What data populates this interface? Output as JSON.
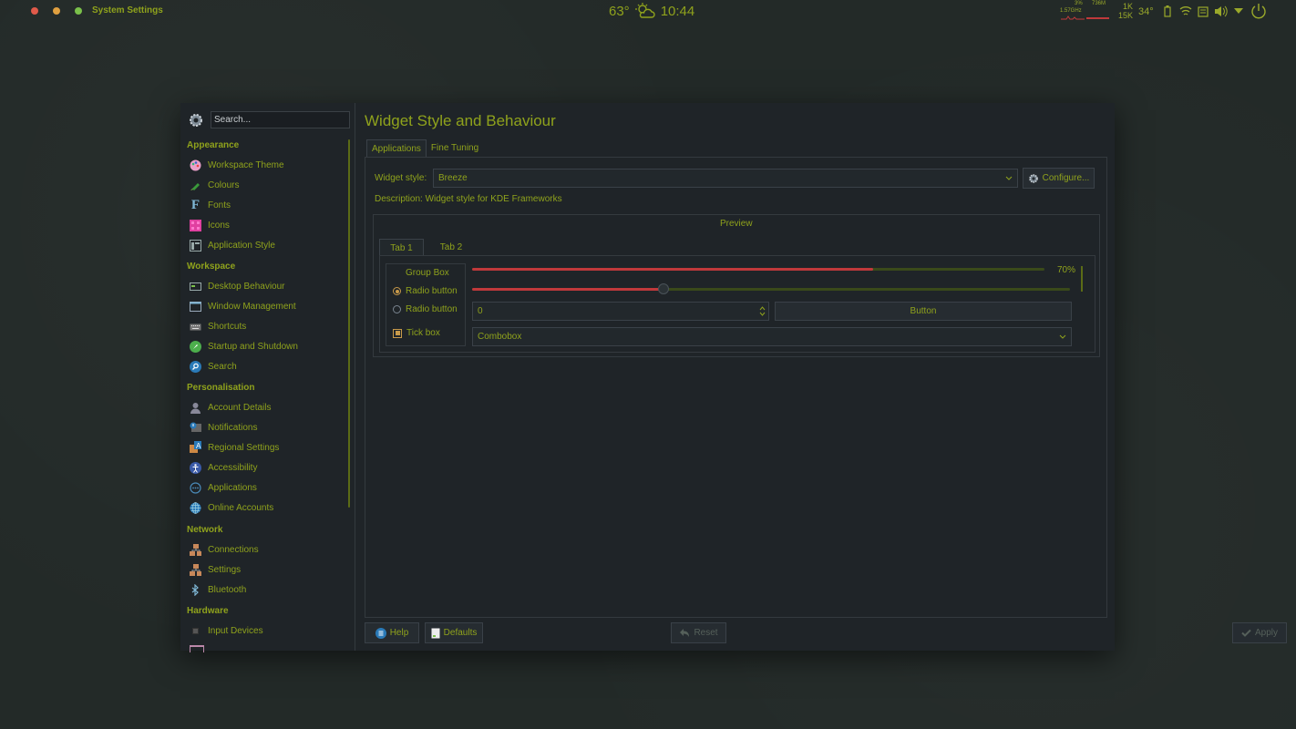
{
  "topbar": {
    "app_name": "System Settings",
    "temperature": "63°",
    "time": "10:44",
    "weather_icon": "partly-cloudy-icon",
    "window_controls": {
      "close_color": "#e05a4a",
      "minimize_color": "#e0a040",
      "maximize_color": "#7ac04a"
    },
    "tray": {
      "cpu_percent": "3%",
      "cpu_freq": "1.57GHz",
      "mem": "736M",
      "net_up": "1K",
      "net_down": "15K",
      "cpu_temp": "34°"
    }
  },
  "sidebar": {
    "search_placeholder": "Search...",
    "sections": [
      {
        "title": "Appearance",
        "items": [
          {
            "label": "Workspace Theme",
            "icon": "palette-icon"
          },
          {
            "label": "Colours",
            "icon": "paint-icon"
          },
          {
            "label": "Fonts",
            "icon": "font-icon"
          },
          {
            "label": "Icons",
            "icon": "icons-grid-icon"
          },
          {
            "label": "Application Style",
            "icon": "app-style-icon"
          }
        ]
      },
      {
        "title": "Workspace",
        "items": [
          {
            "label": "Desktop Behaviour",
            "icon": "desktop-icon"
          },
          {
            "label": "Window Management",
            "icon": "window-icon"
          },
          {
            "label": "Shortcuts",
            "icon": "keyboard-icon"
          },
          {
            "label": "Startup and Shutdown",
            "icon": "rocket-icon"
          },
          {
            "label": "Search",
            "icon": "search-icon"
          }
        ]
      },
      {
        "title": "Personalisation",
        "items": [
          {
            "label": "Account Details",
            "icon": "user-icon"
          },
          {
            "label": "Notifications",
            "icon": "notification-icon"
          },
          {
            "label": "Regional Settings",
            "icon": "language-icon"
          },
          {
            "label": "Accessibility",
            "icon": "accessibility-icon"
          },
          {
            "label": "Applications",
            "icon": "applications-icon"
          },
          {
            "label": "Online Accounts",
            "icon": "globe-icon"
          }
        ]
      },
      {
        "title": "Network",
        "items": [
          {
            "label": "Connections",
            "icon": "network-icon"
          },
          {
            "label": "Settings",
            "icon": "network-settings-icon"
          },
          {
            "label": "Bluetooth",
            "icon": "bluetooth-icon"
          }
        ]
      },
      {
        "title": "Hardware",
        "items": [
          {
            "label": "Input Devices",
            "icon": "input-devices-icon"
          }
        ]
      }
    ]
  },
  "main": {
    "title": "Widget Style and Behaviour",
    "tabs": [
      "Applications",
      "Fine Tuning"
    ],
    "widget_style_label": "Widget style:",
    "widget_style_value": "Breeze",
    "configure_label": "Configure...",
    "description": "Description: Widget style for KDE Frameworks",
    "preview": {
      "title": "Preview",
      "tabs": [
        "Tab 1",
        "Tab 2"
      ],
      "group_box_title": "Group Box",
      "radio1": "Radio button",
      "radio2": "Radio button",
      "tick_box": "Tick box",
      "progress_value": 0.7,
      "progress_label": "70%",
      "slider_value": 0.32,
      "spinbox_value": "0",
      "button_label": "Button",
      "combobox_value": "Combobox"
    }
  },
  "footer": {
    "help": "Help",
    "defaults": "Defaults",
    "reset": "Reset",
    "apply": "Apply"
  },
  "colors": {
    "accent": "#8fa21c",
    "progress": "#c0393b",
    "window_bg": "#1f2428",
    "desktop_bg": "#232a28"
  }
}
